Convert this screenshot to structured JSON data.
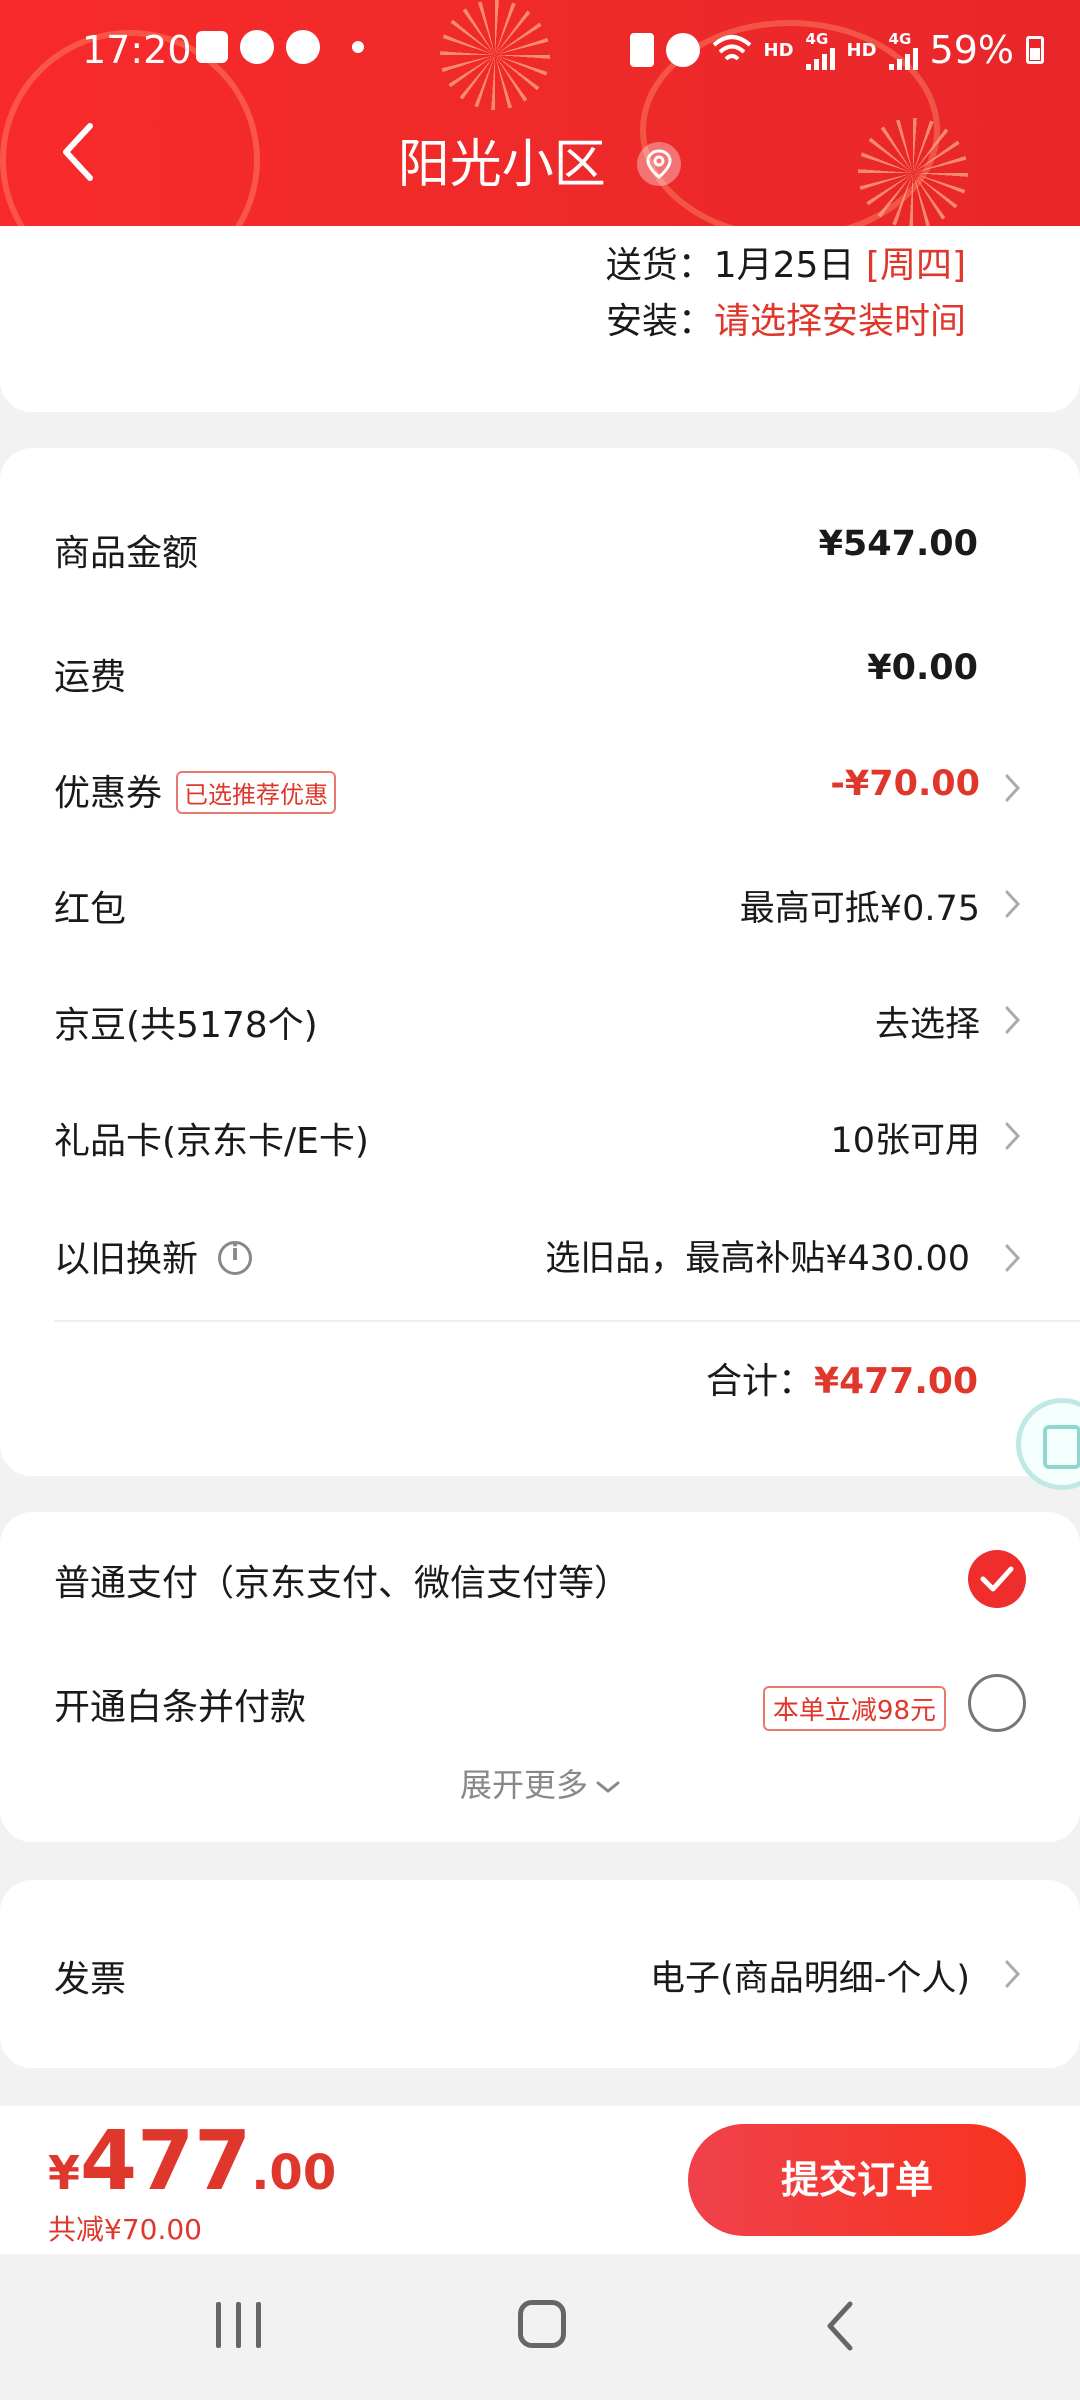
{
  "status_bar": {
    "time": "17:20",
    "network_label_1": "HD",
    "network_gen_1": "4G",
    "network_label_2": "HD",
    "network_gen_2": "4G",
    "battery": "59%"
  },
  "header": {
    "title": "阳光小区",
    "back_icon": "chevron-left-icon",
    "location_icon": "location-pin-icon"
  },
  "delivery": {
    "ship_label": "送货：",
    "ship_date": "1月25日",
    "ship_weekday": "[周四]",
    "install_label": "安装：",
    "install_value": "请选择安装时间"
  },
  "fees": {
    "goods_label": "商品金额",
    "goods_value": "¥547.00",
    "shipping_label": "运费",
    "shipping_value": "¥0.00",
    "coupon_label": "优惠券",
    "coupon_tag": "已选推荐优惠",
    "coupon_value": "-¥70.00",
    "redpacket_label": "红包",
    "redpacket_value": "最高可抵¥0.75",
    "jingdou_label": "京豆(共5178个)",
    "jingdou_value": "去选择",
    "giftcard_label": "礼品卡(京东卡/E卡)",
    "giftcard_value": "10张可用",
    "tradein_label": "以旧换新",
    "tradein_value": "选旧品，最高补贴¥430.00",
    "total_label": "合计：",
    "total_value": "¥477.00"
  },
  "payment": {
    "normal_label": "普通支付（京东支付、微信支付等）",
    "normal_selected": true,
    "baitiao_label": "开通白条并付款",
    "baitiao_tag": "本单立减98元",
    "baitiao_selected": false,
    "expand_label": "展开更多"
  },
  "invoice": {
    "label": "发票",
    "value": "电子(商品明细-个人)"
  },
  "checkout": {
    "currency": "¥",
    "price_int": "477",
    "price_dec": ".00",
    "saved": "共减¥70.00",
    "submit_label": "提交订单"
  },
  "colors": {
    "brand_red": "#e0372c",
    "header_red": "#f8292b"
  }
}
